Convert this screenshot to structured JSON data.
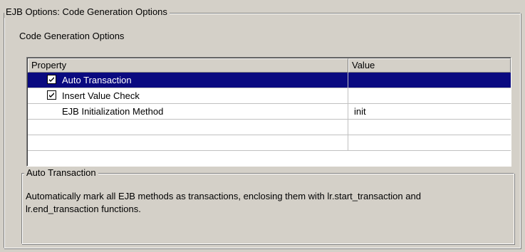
{
  "window": {
    "group_title": "EJB Options:  Code Generation Options",
    "heading": "Code Generation Options"
  },
  "grid": {
    "columns": [
      "Property",
      "Value"
    ],
    "rows": [
      {
        "checked": true,
        "label": "Auto Transaction",
        "value": "",
        "selected": true
      },
      {
        "checked": true,
        "label": "Insert Value Check",
        "value": "",
        "selected": false
      },
      {
        "checked": null,
        "label": "EJB Initialization Method",
        "value": "init",
        "selected": false
      },
      {
        "checked": null,
        "label": "",
        "value": "",
        "selected": false
      },
      {
        "checked": null,
        "label": "",
        "value": "",
        "selected": false
      }
    ]
  },
  "description": {
    "title": "Auto Transaction",
    "text_line1": "Automatically mark all EJB methods as transactions, enclosing them with lr.start_transaction and",
    "text_line2": "lr.end_transaction functions."
  },
  "colors": {
    "dialog_bg": "#d4d0c8",
    "selection_bg": "#0a0a80",
    "selection_fg": "#ffffff"
  },
  "icons": {
    "checkbox": "checkmark-icon"
  }
}
